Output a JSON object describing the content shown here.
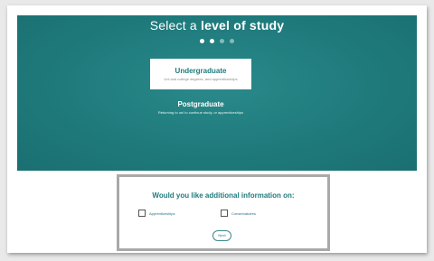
{
  "hero": {
    "title_prefix": "Select a ",
    "title_bold": "level of study",
    "steps": [
      true,
      true,
      false,
      false
    ]
  },
  "options": [
    {
      "title": "Undergraduate",
      "subtitle": "Uni and college degrees, and apprenticeships",
      "selected": true
    },
    {
      "title": "Postgraduate",
      "subtitle": "Returning to uni to continue study, or apprenticeships",
      "selected": false
    }
  ],
  "info_panel": {
    "title": "Would you like additional information on:",
    "checkboxes": [
      {
        "label": "Apprenticeships",
        "checked": false
      },
      {
        "label": "Conservatoires",
        "checked": false
      }
    ],
    "next_label": "Next"
  },
  "colors": {
    "teal": "#1f7a7c",
    "panel_border": "#a9a9a9"
  }
}
